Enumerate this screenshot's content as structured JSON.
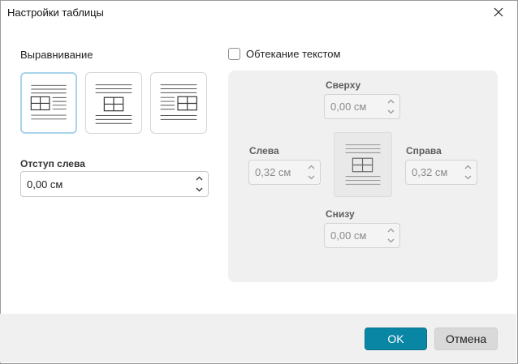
{
  "dialog": {
    "title": "Настройки таблицы",
    "close_icon": "close-icon"
  },
  "alignment": {
    "label": "Выравнивание",
    "options": [
      {
        "name": "left",
        "selected": true
      },
      {
        "name": "center",
        "selected": false
      },
      {
        "name": "right",
        "selected": false
      }
    ]
  },
  "indent": {
    "label": "Отступ слева",
    "value": "0,00 см"
  },
  "wrap": {
    "label": "Обтекание текстом",
    "checked": false,
    "top": {
      "label": "Сверху",
      "value": "0,00 см"
    },
    "left": {
      "label": "Слева",
      "value": "0,32 см"
    },
    "right": {
      "label": "Справа",
      "value": "0,32 см"
    },
    "bottom": {
      "label": "Снизу",
      "value": "0,00 см"
    }
  },
  "buttons": {
    "ok": "OK",
    "cancel": "Отмена"
  },
  "colors": {
    "accent": "#0a86a5",
    "selection_border": "#a9d3ea",
    "panel_bg": "#f0f0f0"
  }
}
